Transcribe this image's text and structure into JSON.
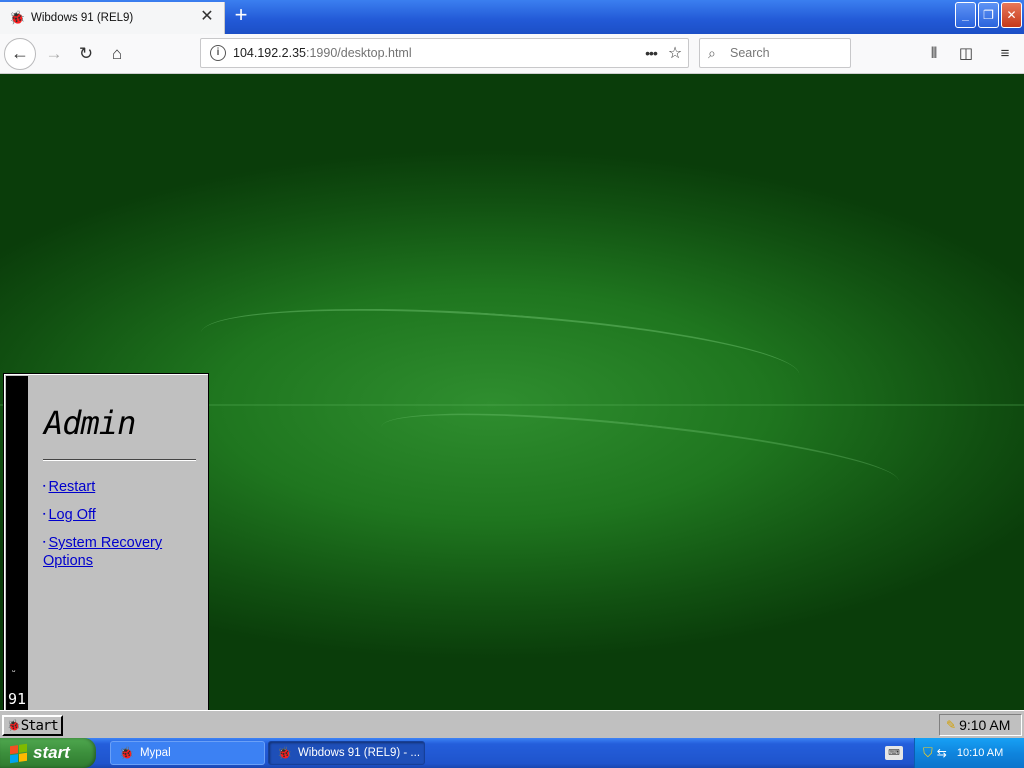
{
  "browser": {
    "tab": {
      "title": "Wibdows 91 (REL9)",
      "favicon": "wibdows-icon",
      "close_glyph": "✕"
    },
    "newtab_glyph": "+",
    "window_buttons": {
      "minimize": "_",
      "restore": "❐",
      "close": "✕"
    },
    "nav": {
      "back": "←",
      "forward": "→",
      "reload": "↻",
      "home": "⌂"
    },
    "url": {
      "host": "104.192.2.35",
      "rest": ":1990/desktop.html",
      "more": "•••",
      "star": "☆"
    },
    "search": {
      "placeholder": "Search",
      "glyph": "⌕"
    },
    "toolbar": {
      "library": "⫴",
      "sidebar": "◫",
      "menu": "≡"
    }
  },
  "wibdows": {
    "startmenu": {
      "title": "Admin",
      "stripe_label": "91",
      "stripe_glyph": "ᵕ",
      "items": [
        {
          "label": "Restart"
        },
        {
          "label": "Log Off"
        },
        {
          "label": "System Recovery Options"
        }
      ],
      "bullet": "▪"
    },
    "taskbar": {
      "start_label": "Start",
      "clock": "9:10 AM"
    }
  },
  "xp": {
    "start_label": "start",
    "flag_colors": [
      "#f25022",
      "#7fba00",
      "#00a4ef",
      "#ffb900"
    ],
    "tasks": [
      {
        "label": "Mypal"
      },
      {
        "label": "Wibdows 91 (REL9) - ..."
      }
    ],
    "clock": "10:10 AM"
  }
}
